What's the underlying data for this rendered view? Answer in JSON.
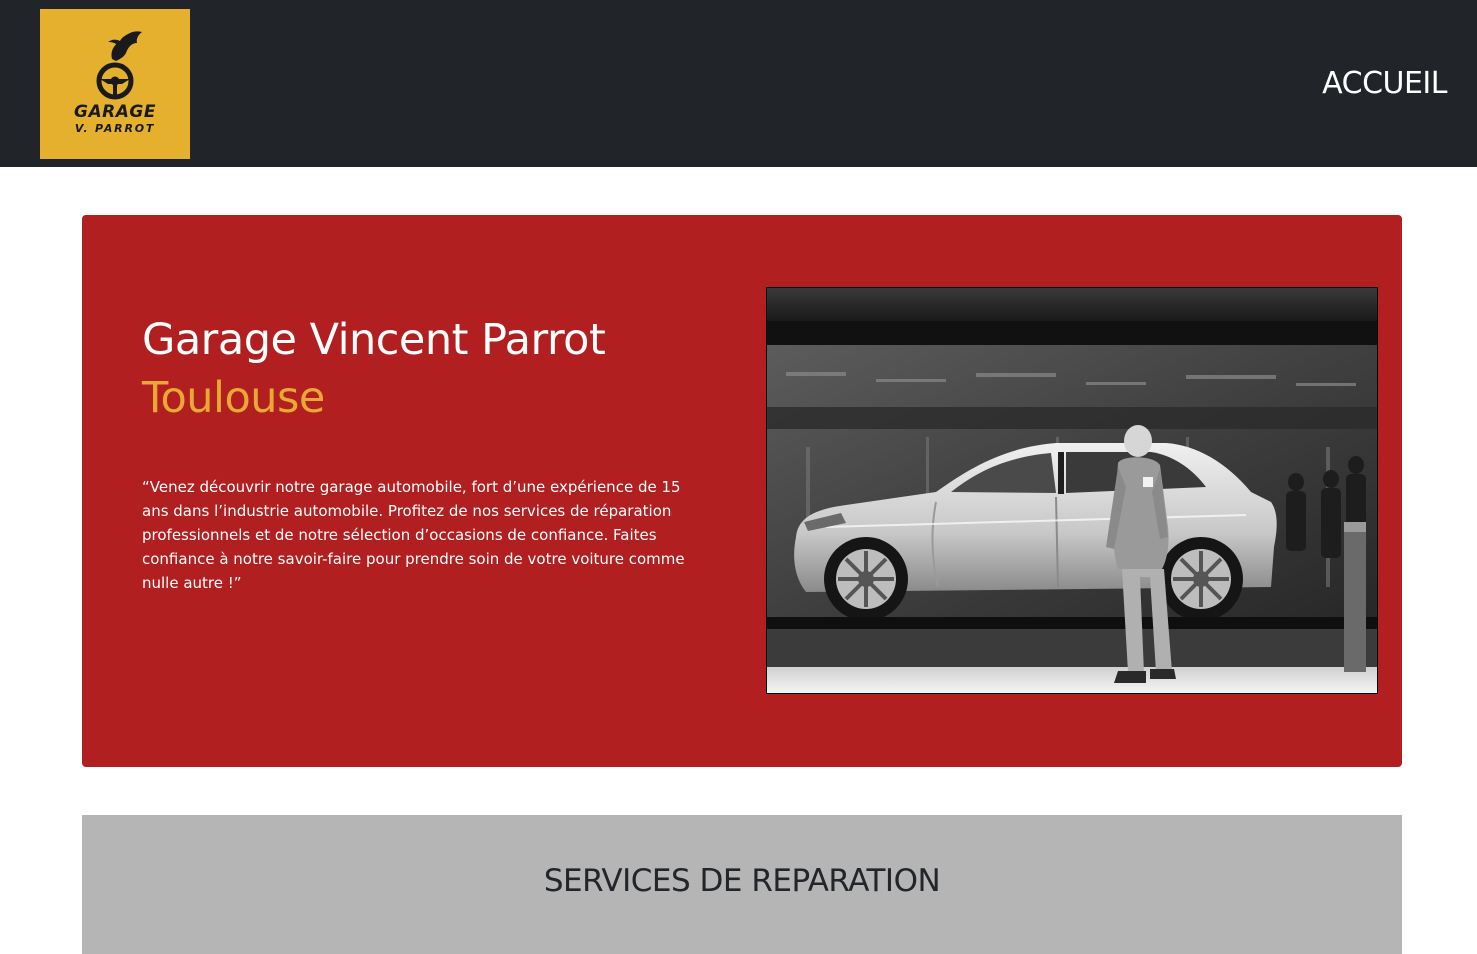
{
  "header": {
    "logo": {
      "line1": "GARAGE",
      "line2": "V. PARROT",
      "background": "#e4b02d"
    },
    "nav": {
      "home_label": "ACCUEIL"
    },
    "background": "#212529"
  },
  "hero": {
    "title": "Garage Vincent Parrot",
    "city": "Toulouse",
    "description": "“Venez découvrir notre garage automobile, fort d’une expérience de 15 ans dans l’industrie automobile. Profitez de nos services de réparation professionnels et de notre sélection d’occasions de confiance. Faites confiance à notre savoir-faire pour prendre soin de votre voiture comme nulle autre !”",
    "background": "#b21f20",
    "accent": "#e9a834",
    "image_icon": "car-showroom-photo"
  },
  "services": {
    "title": "SERVICES DE REPARATION",
    "background": "#b6b5b6"
  }
}
